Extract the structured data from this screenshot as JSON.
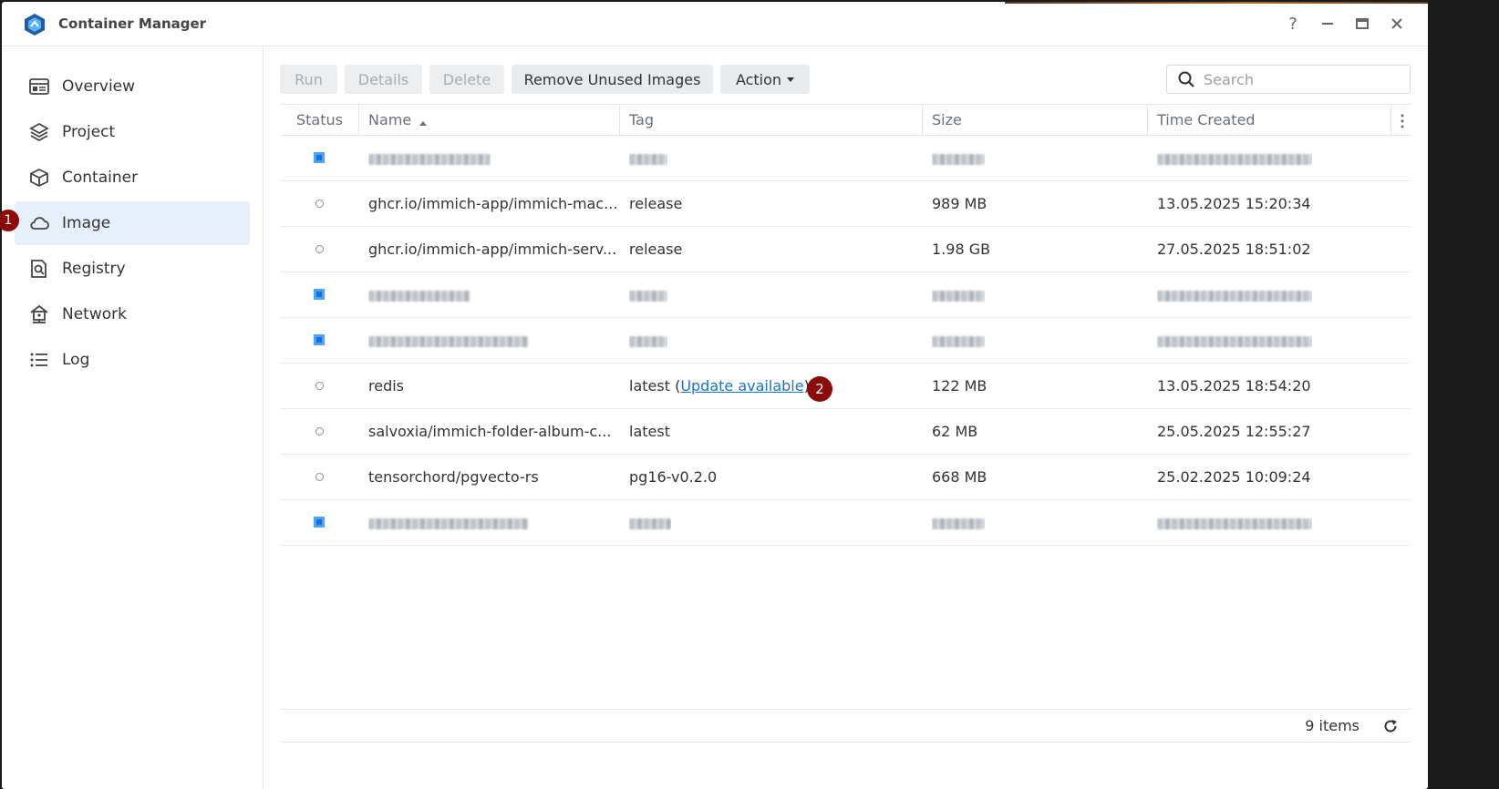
{
  "window": {
    "title": "Container Manager"
  },
  "titlebar": {
    "help": "?",
    "minimize": "—",
    "maximize": "▭",
    "close": "✕"
  },
  "sidebar": {
    "items": [
      {
        "label": "Overview",
        "icon": "overview-icon"
      },
      {
        "label": "Project",
        "icon": "project-icon"
      },
      {
        "label": "Container",
        "icon": "container-icon"
      },
      {
        "label": "Image",
        "icon": "cloud-icon",
        "active": true
      },
      {
        "label": "Registry",
        "icon": "registry-icon"
      },
      {
        "label": "Network",
        "icon": "network-icon"
      },
      {
        "label": "Log",
        "icon": "log-icon"
      }
    ]
  },
  "markers": {
    "m1": "1",
    "m2": "2"
  },
  "toolbar": {
    "run": "Run",
    "details": "Details",
    "delete": "Delete",
    "remove_unused": "Remove Unused Images",
    "action": "Action"
  },
  "search": {
    "placeholder": "Search"
  },
  "table": {
    "headers": {
      "status": "Status",
      "name": "Name",
      "tag": "Tag",
      "size": "Size",
      "time": "Time Created"
    },
    "rows": [
      {
        "status": "running",
        "name": "",
        "tag": "",
        "size": "",
        "time": "",
        "blurred": true
      },
      {
        "status": "stopped",
        "name": "ghcr.io/immich-app/immich-mac...",
        "tag": "release",
        "size": "989 MB",
        "time": "13.05.2025 15:20:34"
      },
      {
        "status": "stopped",
        "name": "ghcr.io/immich-app/immich-serv...",
        "tag": "release",
        "size": "1.98 GB",
        "time": "27.05.2025 18:51:02"
      },
      {
        "status": "running",
        "name": "",
        "tag": "",
        "size": "",
        "time": "",
        "blurred": true
      },
      {
        "status": "running",
        "name": "",
        "tag": "",
        "size": "",
        "time": "",
        "blurred": true
      },
      {
        "status": "stopped",
        "name": "redis",
        "tag": "latest",
        "tag_link": "Update available",
        "size": "122 MB",
        "time": "13.05.2025 18:54:20"
      },
      {
        "status": "stopped",
        "name": "salvoxia/immich-folder-album-c...",
        "tag": "latest",
        "size": "62 MB",
        "time": "25.05.2025 12:55:27"
      },
      {
        "status": "stopped",
        "name": "tensorchord/pgvecto-rs",
        "tag": "pg16-v0.2.0",
        "size": "668 MB",
        "time": "25.02.2025 10:09:24"
      },
      {
        "status": "running",
        "name": "",
        "tag": "",
        "size": "",
        "time": "",
        "blurred": true
      }
    ]
  },
  "footer": {
    "items": "9 items"
  },
  "colors": {
    "accent_blue": "#1a73c6",
    "active_bg": "#e6f0fb",
    "marker": "#8b0a0a"
  }
}
